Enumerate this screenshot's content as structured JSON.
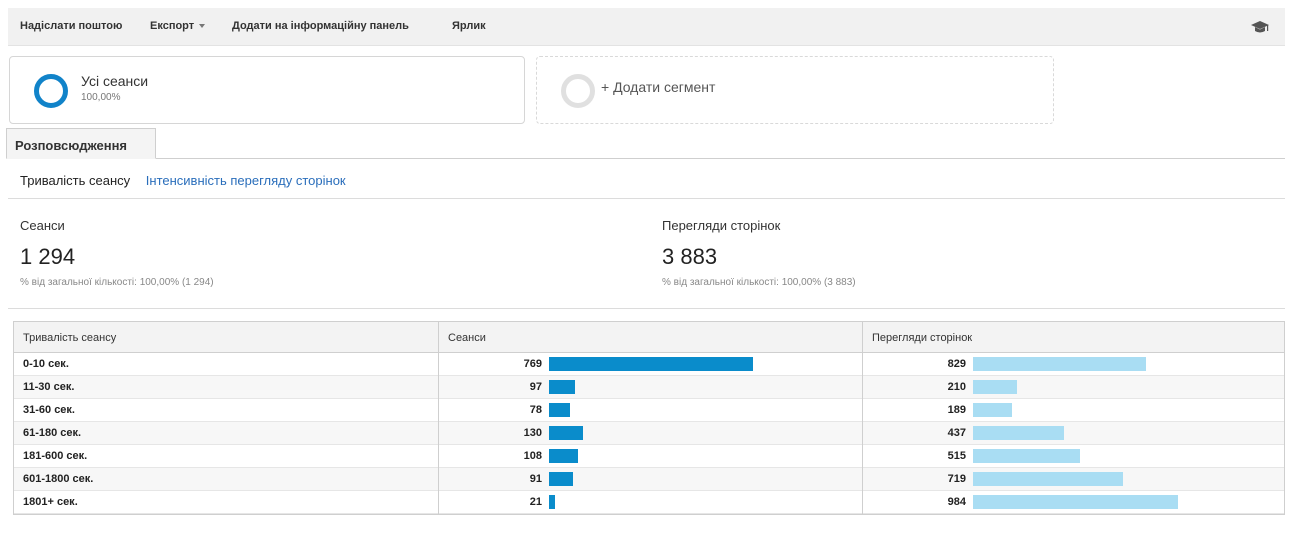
{
  "toolbar": {
    "email": "Надіслати поштою",
    "export": "Експорт",
    "add_dashboard": "Додати на інформаційну панель",
    "shortcut": "Ярлик",
    "help_icon": "graduation-cap-icon"
  },
  "segments": {
    "all_sessions": {
      "name": "Усі сеанси",
      "percent": "100,00%"
    },
    "add_segment": "+ Додати сегмент"
  },
  "tab": "Розповсюдження",
  "subtabs": {
    "active": "Тривалість сеансу",
    "link": "Інтенсивність перегляду сторінок"
  },
  "metrics": {
    "sessions": {
      "label": "Сеанси",
      "value": "1 294",
      "sub": "% від загальної кількості: 100,00% (1 294)"
    },
    "pageviews": {
      "label": "Перегляди сторінок",
      "value": "3 883",
      "sub": "% від загальної кількості: 100,00% (3 883)"
    }
  },
  "table": {
    "columns": [
      "Тривалість сеансу",
      "Сеанси",
      "Перегляди сторінок"
    ],
    "rows": [
      {
        "duration": "0-10 сек.",
        "sessions": 769,
        "pageviews": 829
      },
      {
        "duration": "11-30 сек.",
        "sessions": 97,
        "pageviews": 210
      },
      {
        "duration": "31-60 сек.",
        "sessions": 78,
        "pageviews": 189
      },
      {
        "duration": "61-180 сек.",
        "sessions": 130,
        "pageviews": 437
      },
      {
        "duration": "181-600 сек.",
        "sessions": 108,
        "pageviews": 515
      },
      {
        "duration": "601-1800 сек.",
        "sessions": 91,
        "pageviews": 719
      },
      {
        "duration": "1801+ сек.",
        "sessions": 21,
        "pageviews": 984
      }
    ]
  },
  "colors": {
    "sessions_bar": "#0a8ccb",
    "pageviews_bar": "#a9ddf3",
    "link": "#2a6ebb",
    "segment_ring": "#1183c9"
  }
}
